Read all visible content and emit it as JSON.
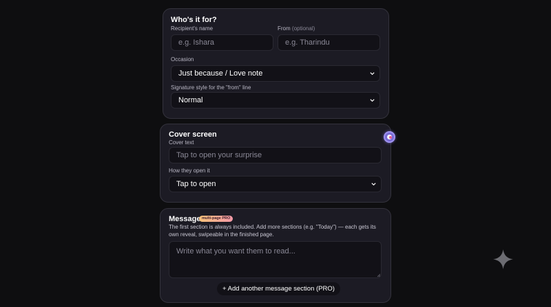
{
  "recipient_card": {
    "title": "Who's it for?",
    "recipient_label": "Recipient's name",
    "recipient_placeholder": "e.g. Ishara",
    "from_label": "From",
    "from_optional": "(optional)",
    "from_placeholder": "e.g. Tharindu",
    "occasion_label": "Occasion",
    "occasion_value": "Just because / Love note",
    "signature_label": "Signature style for the \"from\" line",
    "signature_value": "Normal"
  },
  "cover_card": {
    "title": "Cover screen",
    "cover_text_label": "Cover text",
    "cover_text_placeholder": "Tap to open your surprise",
    "open_label": "How they open it",
    "open_value": "Tap to open"
  },
  "message_card": {
    "title": "Message",
    "badge": "multi-page PRO",
    "description_line1": "The first section is always included. Add more sections (e.g. \"Today\") — each gets its",
    "description_line2": "own reveal, swipeable in the finished page.",
    "textarea_placeholder": "Write what you want them to read...",
    "add_section_button": "+ Add another message section (PRO)"
  },
  "colors": {
    "background": "#0e0e10",
    "card": "#1c1b24",
    "field": "#121117",
    "badge_gradient_start": "#f7c27a",
    "badge_gradient_end": "#f59aa8"
  },
  "icons": {
    "floating": "avatar-toggle-icon",
    "sparkle": "sparkle-icon",
    "select": "chevron-down-icon"
  }
}
